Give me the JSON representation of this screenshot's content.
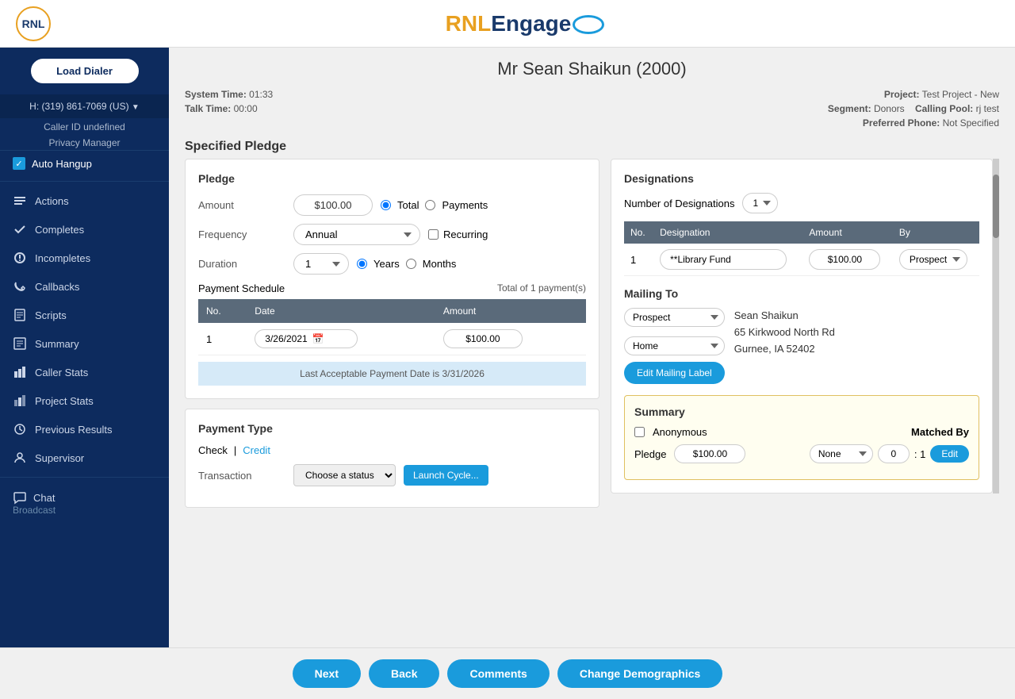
{
  "header": {
    "logo_text": "RNL",
    "brand_left": "RNL",
    "brand_right": "Engage",
    "brand_symbol": "∞",
    "page_title": "Mr Sean Shaikun (2000)"
  },
  "system_info": {
    "system_time_label": "System Time:",
    "system_time_value": "01:33",
    "talk_time_label": "Talk Time:",
    "talk_time_value": "00:00",
    "project_label": "Project:",
    "project_value": "Test Project - New",
    "segment_label": "Segment:",
    "segment_value": "Donors",
    "calling_pool_label": "Calling Pool:",
    "calling_pool_value": "rj test",
    "preferred_phone_label": "Preferred Phone:",
    "preferred_phone_value": "Not Specified"
  },
  "sidebar": {
    "load_dialer": "Load Dialer",
    "phone": "H: (319) 861-7069 (US)",
    "caller_id": "Caller ID undefined",
    "privacy_manager": "Privacy Manager",
    "auto_hangup": "Auto Hangup",
    "nav_items": [
      {
        "id": "actions",
        "label": "Actions"
      },
      {
        "id": "completes",
        "label": "Completes"
      },
      {
        "id": "incompletes",
        "label": "Incompletes"
      },
      {
        "id": "callbacks",
        "label": "Callbacks"
      },
      {
        "id": "scripts",
        "label": "Scripts"
      },
      {
        "id": "summary",
        "label": "Summary"
      },
      {
        "id": "caller-stats",
        "label": "Caller Stats"
      },
      {
        "id": "project-stats",
        "label": "Project Stats"
      },
      {
        "id": "previous-results",
        "label": "Previous Results"
      },
      {
        "id": "supervisor",
        "label": "Supervisor"
      }
    ],
    "chat_label": "Chat",
    "broadcast_label": "Broadcast"
  },
  "section_title": "Specified Pledge",
  "pledge": {
    "title": "Pledge",
    "amount_label": "Amount",
    "amount_value": "$100.00",
    "total_label": "Total",
    "payments_label": "Payments",
    "frequency_label": "Frequency",
    "frequency_value": "Annual",
    "recurring_label": "Recurring",
    "duration_label": "Duration",
    "duration_value": "1",
    "years_label": "Years",
    "months_label": "Months",
    "payment_schedule_label": "Payment Schedule",
    "total_payments": "Total of 1 payment(s)",
    "schedule_col_no": "No.",
    "schedule_col_date": "Date",
    "schedule_col_amount": "Amount",
    "schedule_row": {
      "no": "1",
      "date": "3/26/2021",
      "amount": "$100.00"
    },
    "last_acceptable": "Last Acceptable Payment Date is 3/31/2026"
  },
  "payment_type": {
    "title": "Payment Type",
    "check_label": "Check",
    "credit_label": "Credit",
    "transaction_label": "Transaction",
    "choose_status": "Choose a status",
    "launch_cycle": "Launch Cycle..."
  },
  "designations": {
    "title": "Designations",
    "num_label": "Number of Designations",
    "num_value": "1",
    "col_no": "No.",
    "col_designation": "Designation",
    "col_amount": "Amount",
    "col_by": "By",
    "row": {
      "no": "1",
      "designation": "**Library Fund",
      "amount": "$100.00",
      "by": "Prospect"
    }
  },
  "mailing_to": {
    "title": "Mailing To",
    "prospect_value": "Prospect",
    "home_value": "Home",
    "name": "Sean Shaikun",
    "address1": "65 Kirkwood North Rd",
    "city_state_zip": "Gurnee, IA 52402",
    "edit_label_btn": "Edit Mailing Label"
  },
  "summary": {
    "title": "Summary",
    "anonymous_label": "Anonymous",
    "pledge_label": "Pledge",
    "pledge_value": "$100.00",
    "matched_by_label": "Matched By",
    "none_value": "None",
    "ratio_left": "0",
    "ratio_separator": ": 1",
    "edit_btn": "Edit"
  },
  "bottom_buttons": {
    "next": "Next",
    "back": "Back",
    "comments": "Comments",
    "change_demographics": "Change Demographics"
  }
}
